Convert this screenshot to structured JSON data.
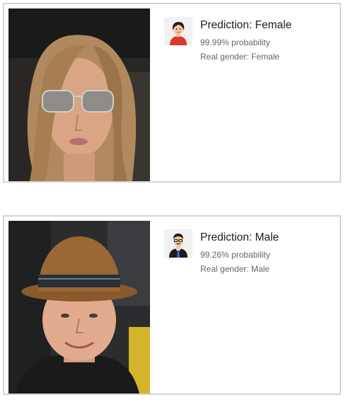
{
  "results": [
    {
      "photo": "woman with long light-brown hair and aviator sunglasses",
      "avatar_icon": "female-avatar-icon",
      "prediction_prefix": "Prediction:",
      "prediction": "Female",
      "probability": "99.99% probability",
      "real_gender": "Real gender: Female"
    },
    {
      "photo": "man wearing a brown fedora hat",
      "avatar_icon": "male-avatar-icon",
      "prediction_prefix": "Prediction:",
      "prediction": "Male",
      "probability": "99.26% probability",
      "real_gender": "Real gender: Male"
    }
  ],
  "colors": {
    "card_border": "#d4d4d4",
    "text_primary": "#1d1d1d",
    "text_secondary": "#666666",
    "avatar_bg": "#f1f1f1",
    "female_shirt": "#d93a2a",
    "male_tie": "#2a6fd1"
  }
}
